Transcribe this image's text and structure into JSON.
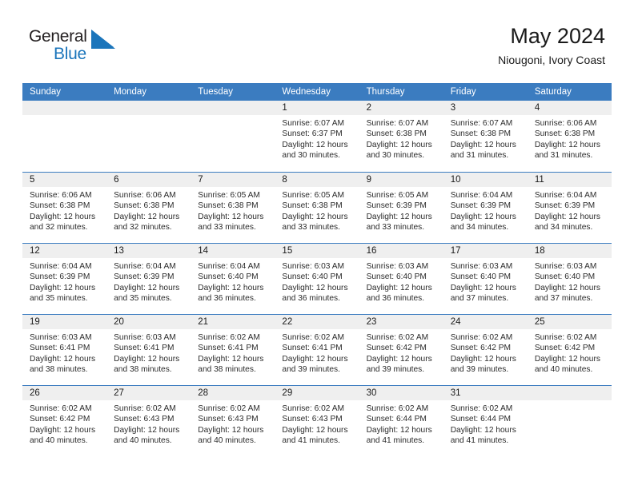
{
  "brand": {
    "name_part1": "General",
    "name_part2": "Blue",
    "mark": "triangle-logo-icon",
    "color_dark": "#231f20",
    "color_blue": "#1b75bb"
  },
  "header": {
    "title": "May 2024",
    "subtitle": "Niougoni, Ivory Coast"
  },
  "theme": {
    "header_bar": "#3b7cc0",
    "day_strip": "#efefef",
    "text": "#1a1a1a"
  },
  "calendar": {
    "weekday_headers": [
      "Sunday",
      "Monday",
      "Tuesday",
      "Wednesday",
      "Thursday",
      "Friday",
      "Saturday"
    ],
    "weeks": [
      [
        {
          "day": "",
          "lines": []
        },
        {
          "day": "",
          "lines": []
        },
        {
          "day": "",
          "lines": []
        },
        {
          "day": "1",
          "lines": [
            "Sunrise: 6:07 AM",
            "Sunset: 6:37 PM",
            "Daylight: 12 hours",
            "and 30 minutes."
          ]
        },
        {
          "day": "2",
          "lines": [
            "Sunrise: 6:07 AM",
            "Sunset: 6:38 PM",
            "Daylight: 12 hours",
            "and 30 minutes."
          ]
        },
        {
          "day": "3",
          "lines": [
            "Sunrise: 6:07 AM",
            "Sunset: 6:38 PM",
            "Daylight: 12 hours",
            "and 31 minutes."
          ]
        },
        {
          "day": "4",
          "lines": [
            "Sunrise: 6:06 AM",
            "Sunset: 6:38 PM",
            "Daylight: 12 hours",
            "and 31 minutes."
          ]
        }
      ],
      [
        {
          "day": "5",
          "lines": [
            "Sunrise: 6:06 AM",
            "Sunset: 6:38 PM",
            "Daylight: 12 hours",
            "and 32 minutes."
          ]
        },
        {
          "day": "6",
          "lines": [
            "Sunrise: 6:06 AM",
            "Sunset: 6:38 PM",
            "Daylight: 12 hours",
            "and 32 minutes."
          ]
        },
        {
          "day": "7",
          "lines": [
            "Sunrise: 6:05 AM",
            "Sunset: 6:38 PM",
            "Daylight: 12 hours",
            "and 33 minutes."
          ]
        },
        {
          "day": "8",
          "lines": [
            "Sunrise: 6:05 AM",
            "Sunset: 6:38 PM",
            "Daylight: 12 hours",
            "and 33 minutes."
          ]
        },
        {
          "day": "9",
          "lines": [
            "Sunrise: 6:05 AM",
            "Sunset: 6:39 PM",
            "Daylight: 12 hours",
            "and 33 minutes."
          ]
        },
        {
          "day": "10",
          "lines": [
            "Sunrise: 6:04 AM",
            "Sunset: 6:39 PM",
            "Daylight: 12 hours",
            "and 34 minutes."
          ]
        },
        {
          "day": "11",
          "lines": [
            "Sunrise: 6:04 AM",
            "Sunset: 6:39 PM",
            "Daylight: 12 hours",
            "and 34 minutes."
          ]
        }
      ],
      [
        {
          "day": "12",
          "lines": [
            "Sunrise: 6:04 AM",
            "Sunset: 6:39 PM",
            "Daylight: 12 hours",
            "and 35 minutes."
          ]
        },
        {
          "day": "13",
          "lines": [
            "Sunrise: 6:04 AM",
            "Sunset: 6:39 PM",
            "Daylight: 12 hours",
            "and 35 minutes."
          ]
        },
        {
          "day": "14",
          "lines": [
            "Sunrise: 6:04 AM",
            "Sunset: 6:40 PM",
            "Daylight: 12 hours",
            "and 36 minutes."
          ]
        },
        {
          "day": "15",
          "lines": [
            "Sunrise: 6:03 AM",
            "Sunset: 6:40 PM",
            "Daylight: 12 hours",
            "and 36 minutes."
          ]
        },
        {
          "day": "16",
          "lines": [
            "Sunrise: 6:03 AM",
            "Sunset: 6:40 PM",
            "Daylight: 12 hours",
            "and 36 minutes."
          ]
        },
        {
          "day": "17",
          "lines": [
            "Sunrise: 6:03 AM",
            "Sunset: 6:40 PM",
            "Daylight: 12 hours",
            "and 37 minutes."
          ]
        },
        {
          "day": "18",
          "lines": [
            "Sunrise: 6:03 AM",
            "Sunset: 6:40 PM",
            "Daylight: 12 hours",
            "and 37 minutes."
          ]
        }
      ],
      [
        {
          "day": "19",
          "lines": [
            "Sunrise: 6:03 AM",
            "Sunset: 6:41 PM",
            "Daylight: 12 hours",
            "and 38 minutes."
          ]
        },
        {
          "day": "20",
          "lines": [
            "Sunrise: 6:03 AM",
            "Sunset: 6:41 PM",
            "Daylight: 12 hours",
            "and 38 minutes."
          ]
        },
        {
          "day": "21",
          "lines": [
            "Sunrise: 6:02 AM",
            "Sunset: 6:41 PM",
            "Daylight: 12 hours",
            "and 38 minutes."
          ]
        },
        {
          "day": "22",
          "lines": [
            "Sunrise: 6:02 AM",
            "Sunset: 6:41 PM",
            "Daylight: 12 hours",
            "and 39 minutes."
          ]
        },
        {
          "day": "23",
          "lines": [
            "Sunrise: 6:02 AM",
            "Sunset: 6:42 PM",
            "Daylight: 12 hours",
            "and 39 minutes."
          ]
        },
        {
          "day": "24",
          "lines": [
            "Sunrise: 6:02 AM",
            "Sunset: 6:42 PM",
            "Daylight: 12 hours",
            "and 39 minutes."
          ]
        },
        {
          "day": "25",
          "lines": [
            "Sunrise: 6:02 AM",
            "Sunset: 6:42 PM",
            "Daylight: 12 hours",
            "and 40 minutes."
          ]
        }
      ],
      [
        {
          "day": "26",
          "lines": [
            "Sunrise: 6:02 AM",
            "Sunset: 6:42 PM",
            "Daylight: 12 hours",
            "and 40 minutes."
          ]
        },
        {
          "day": "27",
          "lines": [
            "Sunrise: 6:02 AM",
            "Sunset: 6:43 PM",
            "Daylight: 12 hours",
            "and 40 minutes."
          ]
        },
        {
          "day": "28",
          "lines": [
            "Sunrise: 6:02 AM",
            "Sunset: 6:43 PM",
            "Daylight: 12 hours",
            "and 40 minutes."
          ]
        },
        {
          "day": "29",
          "lines": [
            "Sunrise: 6:02 AM",
            "Sunset: 6:43 PM",
            "Daylight: 12 hours",
            "and 41 minutes."
          ]
        },
        {
          "day": "30",
          "lines": [
            "Sunrise: 6:02 AM",
            "Sunset: 6:44 PM",
            "Daylight: 12 hours",
            "and 41 minutes."
          ]
        },
        {
          "day": "31",
          "lines": [
            "Sunrise: 6:02 AM",
            "Sunset: 6:44 PM",
            "Daylight: 12 hours",
            "and 41 minutes."
          ]
        },
        {
          "day": "",
          "lines": []
        }
      ]
    ]
  }
}
